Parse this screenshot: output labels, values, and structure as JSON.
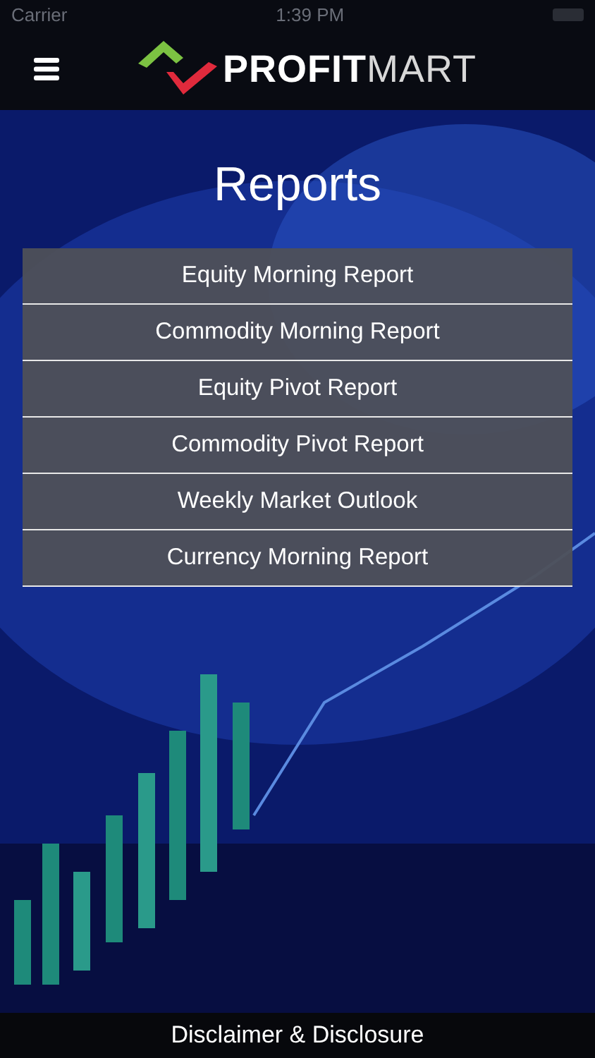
{
  "status_bar": {
    "carrier": "Carrier",
    "time": "1:39 PM"
  },
  "header": {
    "logo": "**PROFIT**MART"
  },
  "title": "Reports",
  "reports": [
    "Equity Morning Report",
    "Commodity Morning Report",
    "Equity Pivot Report",
    "Commodity Pivot Report",
    "Weekly Market Outlook",
    "Currency Morning Report"
  ],
  "footer": {
    "link": "Disclaimer & Disclosure"
  }
}
